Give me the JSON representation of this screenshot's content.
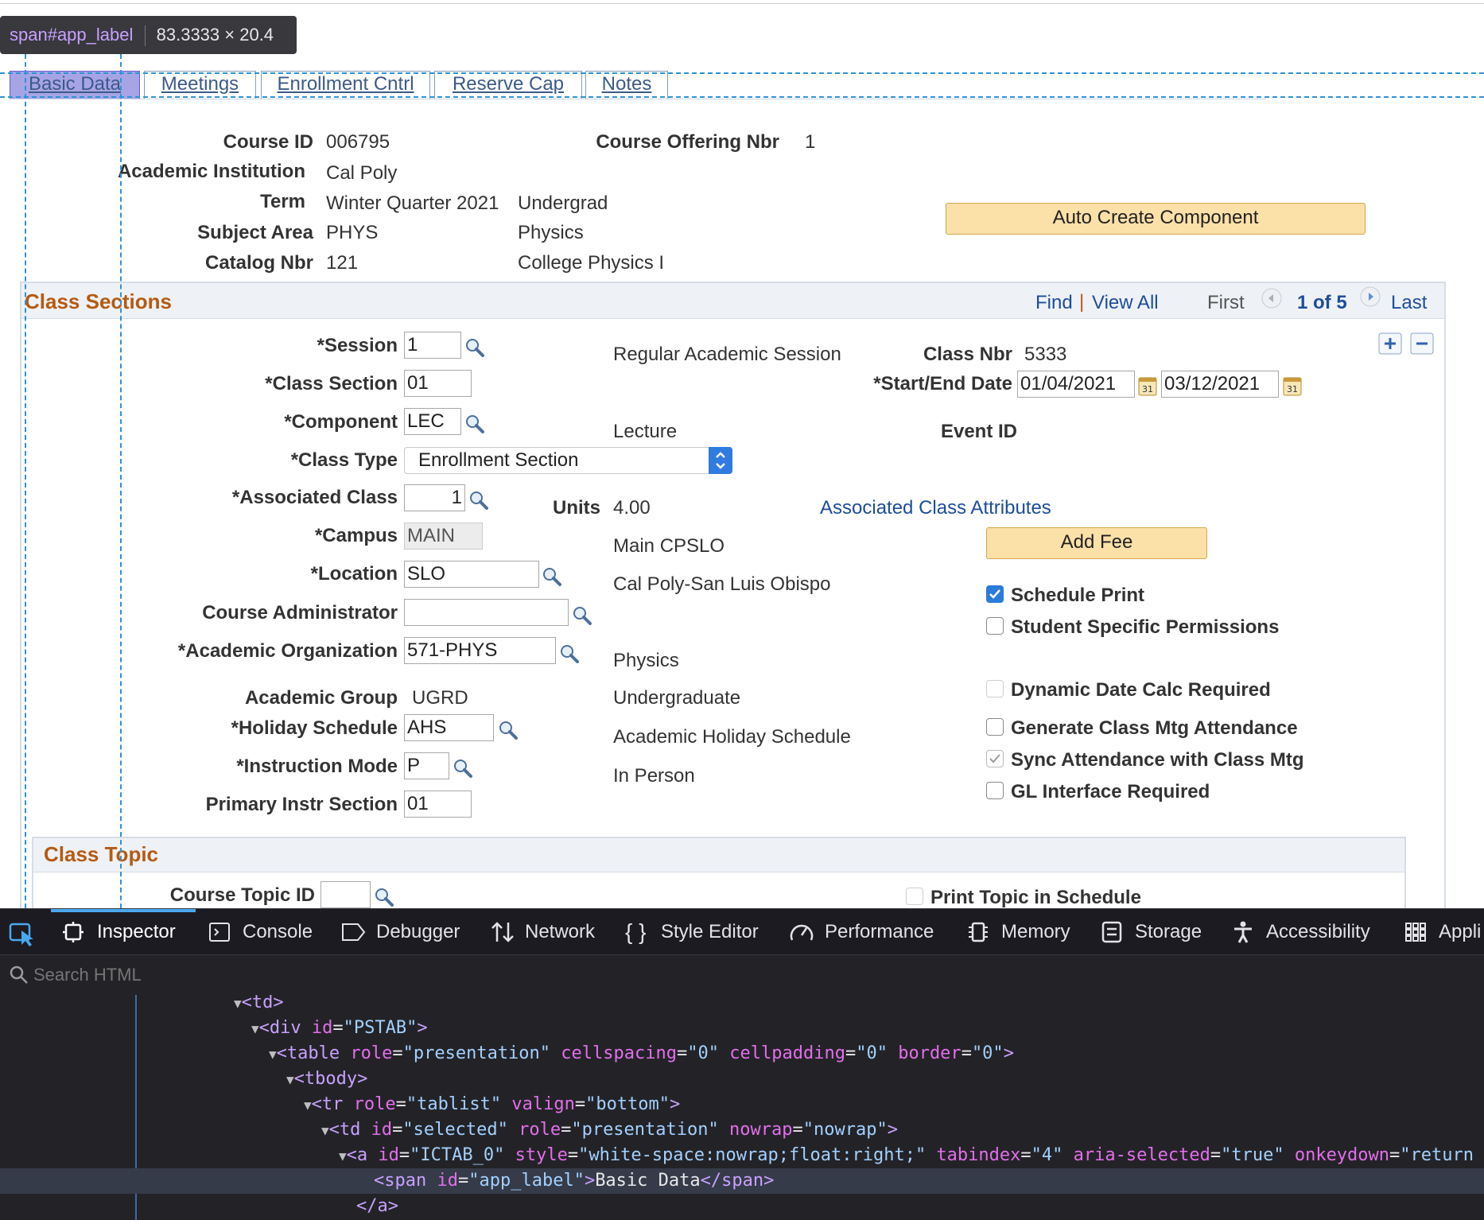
{
  "tooltip": {
    "selector": "span#app_label",
    "size": "83.3333 × 20.4"
  },
  "tabs": [
    "Basic Data",
    "Meetings",
    "Enrollment Cntrl",
    "Reserve Cap",
    "Notes"
  ],
  "header": {
    "course_id_label": "Course ID",
    "course_id": "006795",
    "offering_label": "Course Offering Nbr",
    "offering": "1",
    "institution_label": "Academic Institution",
    "institution": "Cal Poly",
    "term_label": "Term",
    "term": "Winter Quarter 2021",
    "career": "Undergrad",
    "subject_label": "Subject Area",
    "subject": "PHYS",
    "subject_desc": "Physics",
    "catalog_label": "Catalog Nbr",
    "catalog": "121",
    "catalog_desc": "College Physics I",
    "auto_create": "Auto Create Component"
  },
  "class_sections": {
    "title": "Class Sections",
    "nav": {
      "find": "Find",
      "sep": "|",
      "view_all": "View All",
      "first": "First",
      "count": "1 of 5",
      "last": "Last"
    },
    "fields": {
      "session_label": "*Session",
      "session": "1",
      "session_desc": "Regular Academic Session",
      "class_nbr_label": "Class Nbr",
      "class_nbr": "5333",
      "section_label": "*Class Section",
      "section": "01",
      "dates_label": "*Start/End Date",
      "start": "01/04/2021",
      "end": "03/12/2021",
      "component_label": "*Component",
      "component": "LEC",
      "component_desc": "Lecture",
      "event_label": "Event ID",
      "class_type_label": "*Class Type",
      "class_type": "Enrollment Section",
      "assoc_label": "*Associated Class",
      "assoc": "1",
      "units_label": "Units",
      "units": "4.00",
      "assoc_attr_link": "Associated Class Attributes",
      "campus_label": "*Campus",
      "campus": "MAIN",
      "campus_desc": "Main CPSLO",
      "add_fee": "Add Fee",
      "location_label": "*Location",
      "location": "SLO",
      "location_desc": "Cal Poly-San Luis Obispo",
      "admin_label": "Course Administrator",
      "admin": "",
      "acad_org_label": "*Academic Organization",
      "acad_org": "571-PHYS",
      "acad_org_desc": "Physics",
      "acad_group_label": "Academic Group",
      "acad_group": "UGRD",
      "acad_group_desc": "Undergraduate",
      "holiday_label": "*Holiday Schedule",
      "holiday": "AHS",
      "holiday_desc": "Academic Holiday Schedule",
      "instr_mode_label": "*Instruction Mode",
      "instr_mode": "P",
      "instr_mode_desc": "In Person",
      "primary_label": "Primary Instr Section",
      "primary": "01"
    },
    "checkboxes": {
      "schedule_print": "Schedule Print",
      "student_perm": "Student Specific Permissions",
      "dynamic_date": "Dynamic Date Calc Required",
      "generate_att": "Generate Class Mtg Attendance",
      "sync_att": "Sync Attendance with Class Mtg",
      "gl_interface": "GL Interface Required"
    }
  },
  "class_topic": {
    "title": "Class Topic",
    "topic_id_label": "Course Topic ID",
    "topic_id": "",
    "print_topic": "Print Topic in Schedule"
  },
  "devtools": {
    "tabs": [
      "Inspector",
      "Console",
      "Debugger",
      "Network",
      "Style Editor",
      "Performance",
      "Memory",
      "Storage",
      "Accessibility",
      "Appli"
    ],
    "search_placeholder": "Search HTML"
  },
  "colors": {
    "section_title": "#b55a12",
    "link": "#1d4d9a",
    "button_bg": "#fbe0a8",
    "guide": "#2f93d8",
    "devtools_bg": "#232327"
  }
}
